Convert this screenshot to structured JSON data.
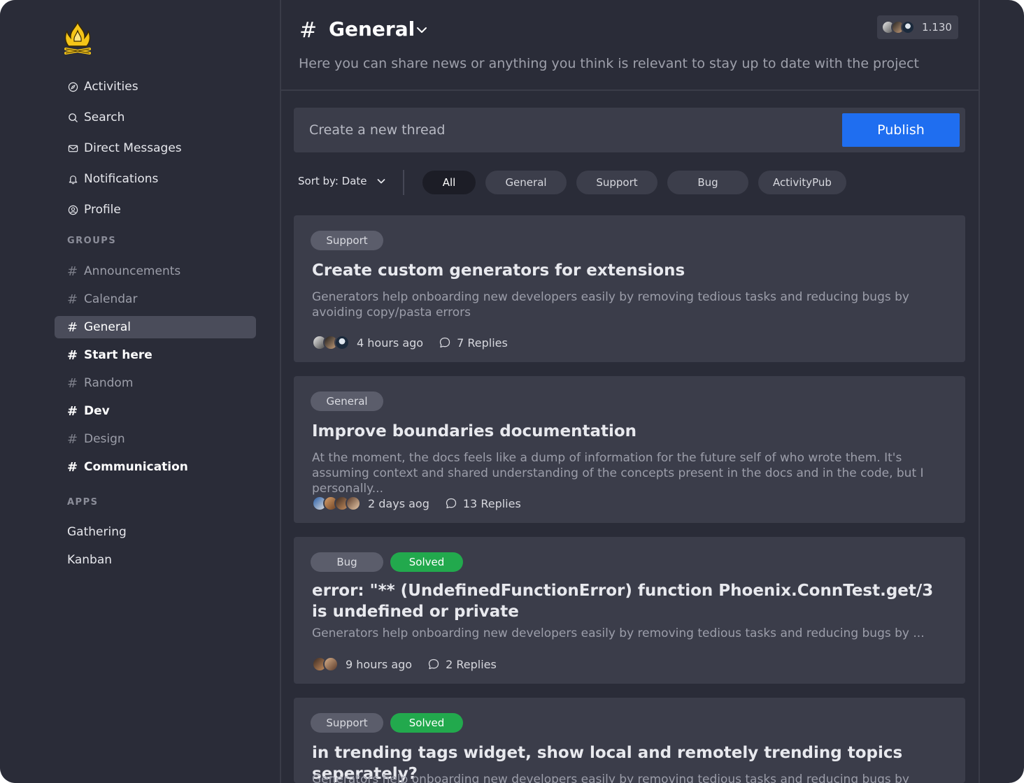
{
  "sidebar": {
    "logo": "campfire-logo",
    "nav": [
      {
        "label": "Activities",
        "icon": "compass-icon"
      },
      {
        "label": "Search",
        "icon": "search-icon"
      },
      {
        "label": "Direct Messages",
        "icon": "mail-icon"
      },
      {
        "label": "Notifications",
        "icon": "bell-icon"
      },
      {
        "label": "Profile",
        "icon": "user-circle-icon"
      }
    ],
    "groups_label": "GROUPS",
    "groups": [
      {
        "label": "Announcements"
      },
      {
        "label": "Calendar"
      },
      {
        "label": "General"
      },
      {
        "label": "Start here"
      },
      {
        "label": "Random"
      },
      {
        "label": "Dev"
      },
      {
        "label": "Design"
      },
      {
        "label": "Communication"
      }
    ],
    "apps_label": "APPS",
    "apps": [
      {
        "label": "Gathering"
      },
      {
        "label": "Kanban"
      }
    ]
  },
  "header": {
    "hash": "#",
    "title": "General",
    "member_count": "1.130",
    "description": "Here you can share news or anything you think is relevant to stay up to date with the project"
  },
  "composer": {
    "placeholder": "Create a new thread",
    "publish_label": "Publish"
  },
  "filters": {
    "sort_label": "Sort by: Date",
    "tags": [
      "All",
      "General",
      "Support",
      "Bug",
      "ActivityPub"
    ],
    "active": "All"
  },
  "threads": [
    {
      "tags": [
        "Support"
      ],
      "title": "Create custom generators for extensions",
      "body": "Generators help onboarding new developers easily by removing tedious tasks and reducing bugs by avoiding copy/pasta errors",
      "time": "4 hours ago",
      "replies": "7 Replies"
    },
    {
      "tags": [
        "General"
      ],
      "title": "Improve boundaries documentation",
      "body": "At the moment, the docs feels like a dump of information for the future self of who wrote them. It's assuming context and shared understanding of the concepts present in the docs and in the code, but I personally...",
      "time": "2 days aog",
      "replies": "13 Replies"
    },
    {
      "tags": [
        "Bug",
        "Solved"
      ],
      "title": "error: \"** (UndefinedFunctionError) function Phoenix.ConnTest.get/3 is undefined or private",
      "body": "Generators help onboarding new developers easily by removing tedious tasks and reducing bugs by ...",
      "time": "9 hours ago",
      "replies": "2 Replies"
    },
    {
      "tags": [
        "Support",
        "Solved"
      ],
      "title": "in trending tags widget, show local and remotely trending topics seperately?",
      "body": "Generators help onboarding new developers easily by removing tedious tasks and reducing bugs by avoiding",
      "time": "",
      "replies": ""
    }
  ],
  "colors": {
    "background": "#2a2c38",
    "card": "#3b3d4a",
    "accent": "#1f6ef0",
    "solved": "#22a94d"
  }
}
